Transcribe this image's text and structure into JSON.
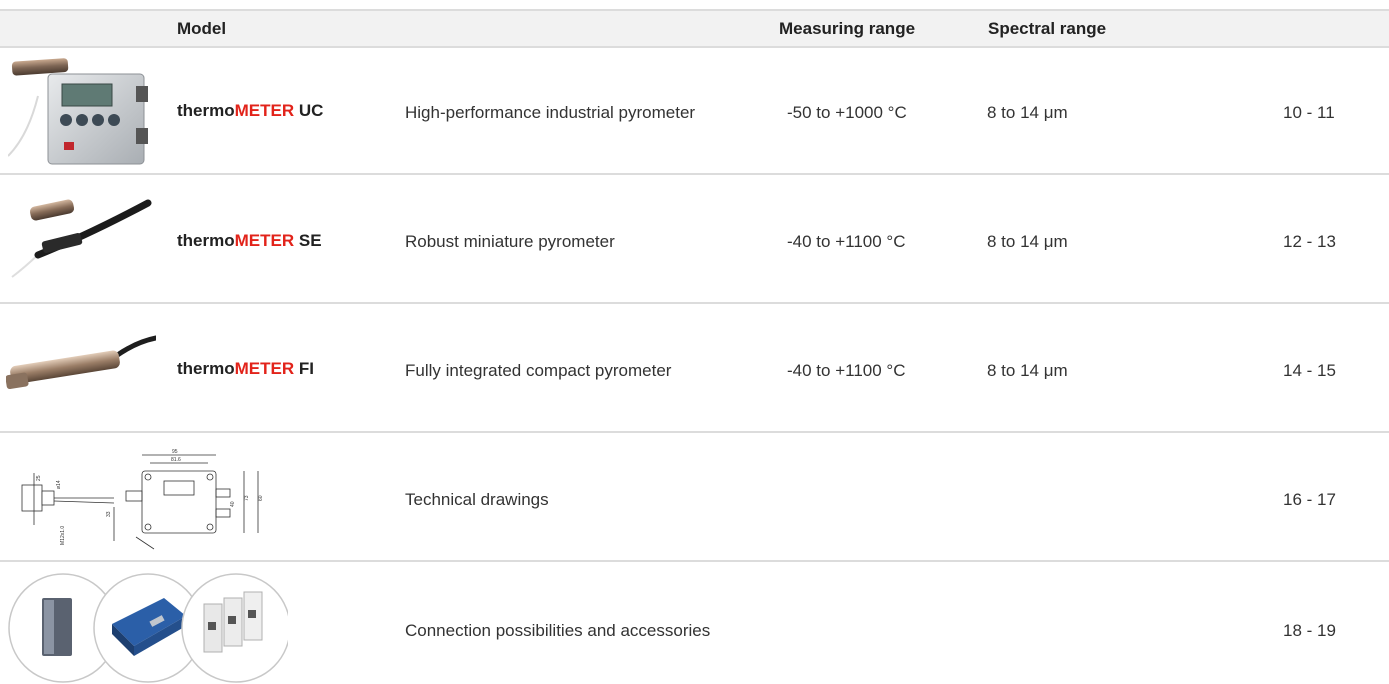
{
  "header": {
    "model": "Model",
    "measuring_range": "Measuring range",
    "spectral_range": "Spectral range"
  },
  "rows": [
    {
      "image": "thermometer-uc-photo",
      "model_prefix": "thermo",
      "model_brand": "METER",
      "model_suffix": "UC",
      "description": "High-performance industrial pyrometer",
      "measuring_range": "-50 to +1000 °C",
      "spectral_range": "8 to 14 μm",
      "pages": "10 - 11"
    },
    {
      "image": "thermometer-se-photo",
      "model_prefix": "thermo",
      "model_brand": "METER",
      "model_suffix": "SE",
      "description": "Robust miniature pyrometer",
      "measuring_range": "-40 to +1100 °C",
      "spectral_range": "8 to 14 μm",
      "pages": "12 - 13"
    },
    {
      "image": "thermometer-fi-photo",
      "model_prefix": "thermo",
      "model_brand": "METER",
      "model_suffix": "FI",
      "description": "Fully integrated compact pyrometer",
      "measuring_range": "-40 to +1100 °C",
      "spectral_range": "8 to 14 μm",
      "pages": "14 - 15"
    },
    {
      "image": "technical-drawing",
      "description": "Technical drawings",
      "pages": "16 - 17",
      "drawing_dims": [
        "95",
        "81.6",
        "73",
        "60",
        "40",
        "ø14",
        "M12x1.0",
        "33",
        "25"
      ]
    },
    {
      "image": "accessories-photos",
      "description": "Connection possibilities and accessories",
      "pages": "18 - 19"
    }
  ],
  "colors": {
    "brand_red": "#e2231a",
    "rule_gray": "#dcdcdc",
    "header_band": "#f2f2f2"
  }
}
